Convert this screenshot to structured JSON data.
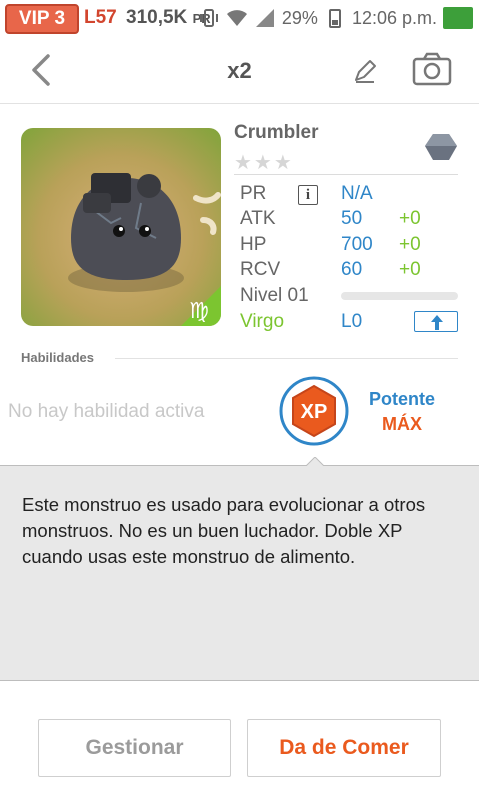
{
  "status_bar": {
    "vip": "VIP 3",
    "level": "L57",
    "power": "310,5K",
    "power_unit": "PR",
    "battery": "29%",
    "time": "12:06 p.m."
  },
  "header": {
    "title": "x2",
    "back_icon": "chevron-left-icon",
    "edit_icon": "pencil-icon",
    "camera_icon": "camera-icon"
  },
  "monster": {
    "name": "Crumbler",
    "stars": "★★★",
    "element_icon": "rock-icon",
    "zodiac_icon": "virgo-icon",
    "stats": [
      {
        "label": "PR",
        "value": "N/A",
        "bonus": ""
      },
      {
        "label": "ATK",
        "value": "50",
        "bonus": "+0"
      },
      {
        "label": "HP",
        "value": "700",
        "bonus": "+0"
      },
      {
        "label": "RCV",
        "value": "60",
        "bonus": "+0"
      }
    ],
    "info_label": "i",
    "level_label": "Nivel 01",
    "level_progress": 0,
    "zodiac": "Virgo",
    "evolution_level": "L0"
  },
  "skills": {
    "heading": "Habilidades",
    "no_active": "No hay habilidad activa",
    "badge": "XP",
    "passive_name": "Potente",
    "passive_level": "MÁX"
  },
  "description": "Este monstruo es usado para evolucionar a otros monstruos. No es un buen luchador. Doble XP cuando usas este monstruo de alimento.",
  "footer": {
    "manage": "Gestionar",
    "feed": "Da de Comer"
  },
  "colors": {
    "accent_blue": "#2f86c8",
    "accent_orange": "#ea5a1e",
    "accent_green": "#7cc530"
  }
}
